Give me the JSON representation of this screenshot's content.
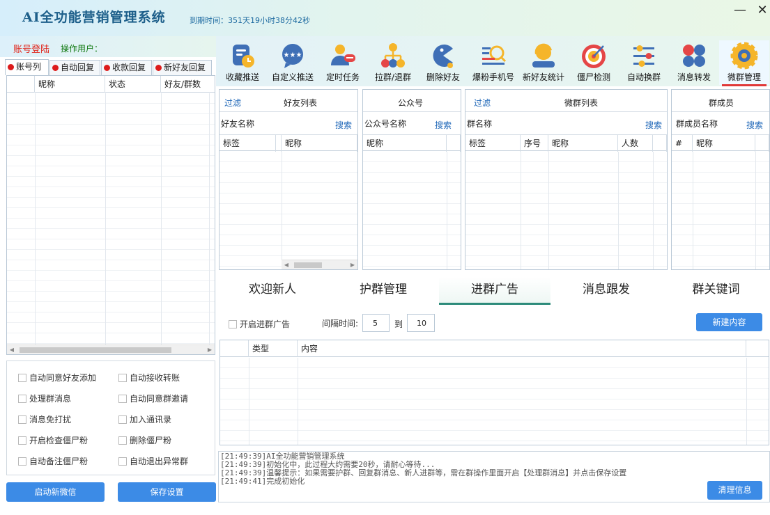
{
  "window": {
    "title": "AI全功能营销管理系统",
    "expiry": "到期时间：351天19小时38分42秒",
    "minimize_glyph": "—",
    "close_glyph": "✕"
  },
  "account": {
    "login": "账号登陆",
    "operator": "操作用户："
  },
  "toolbar": [
    {
      "label": "收藏推送",
      "icon": "bookmark-clock-icon"
    },
    {
      "label": "自定义推送",
      "icon": "chat-bubble-stars-icon"
    },
    {
      "label": "定时任务",
      "icon": "user-message-icon"
    },
    {
      "label": "拉群/退群",
      "icon": "org-tree-icon"
    },
    {
      "label": "删除好友",
      "icon": "pacman-icon"
    },
    {
      "label": "爆粉手机号",
      "icon": "search-list-icon"
    },
    {
      "label": "新好友统计",
      "icon": "user-stats-icon"
    },
    {
      "label": "僵尸检测",
      "icon": "target-icon"
    },
    {
      "label": "自动换群",
      "icon": "sliders-icon"
    },
    {
      "label": "消息转发",
      "icon": "four-dots-icon"
    },
    {
      "label": "微群管理",
      "icon": "gear-icon"
    }
  ],
  "left_tabs": [
    "账号列",
    "自动回复",
    "收款回复",
    "新好友回复"
  ],
  "account_table": {
    "headers": [
      "",
      "昵称",
      "状态",
      "好友/群数"
    ]
  },
  "options": [
    "自动同意好友添加",
    "自动接收转账",
    "处理群消息",
    "自动同意群邀请",
    "消息免打扰",
    "加入通讯录",
    "开启检查僵尸粉",
    "删除僵尸粉",
    "自动备注僵尸粉",
    "自动退出异常群"
  ],
  "buttons": {
    "start_wechat": "启动新微信",
    "save_settings": "保存设置",
    "new_content": "新建内容",
    "clear_info": "清理信息"
  },
  "panels": {
    "friends": {
      "filter": "过滤",
      "title": "好友列表",
      "field": "好友名称",
      "search": "搜索",
      "headers": [
        "标签",
        "昵称"
      ]
    },
    "official": {
      "title": "公众号",
      "field": "公众号名称",
      "search": "搜索",
      "headers": [
        "昵称"
      ]
    },
    "groups": {
      "filter": "过滤",
      "title": "微群列表",
      "field": "群名称",
      "search": "搜索",
      "headers": [
        "标签",
        "序号",
        "昵称",
        "人数"
      ]
    },
    "members": {
      "title": "群成员",
      "field": "群成员名称",
      "search": "搜索",
      "headers": [
        "#",
        "昵称"
      ]
    }
  },
  "content_tabs": [
    "欢迎新人",
    "护群管理",
    "进群广告",
    "消息跟发",
    "群关键词"
  ],
  "ad_settings": {
    "enable": "开启进群广告",
    "interval_label": "间隔时间:",
    "from": "5",
    "to_label": "到",
    "to": "10"
  },
  "content_table": {
    "headers": [
      "",
      "类型",
      "内容"
    ]
  },
  "log": [
    "[21:49:39]AI全功能营销管理系统",
    "[21:49:39]初始化中，此过程大约需要20秒，请耐心等待...",
    "[21:49:39]温馨提示：如果需要护群、回复群消息、新人进群等，需在群操作里面开启【处理群消息】并点击保存设置",
    "[21:49:41]完成初始化"
  ]
}
